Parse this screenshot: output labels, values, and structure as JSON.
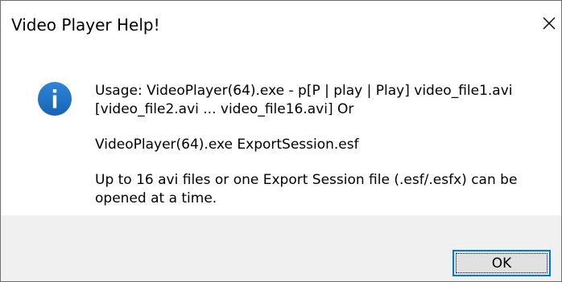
{
  "window": {
    "title": "Video Player Help!"
  },
  "message": {
    "line1": "Usage: VideoPlayer(64).exe - p[P | play | Play]  video_file1.avi",
    "line2": "[video_file2.avi  ...  video_file16.avi] Or",
    "line3": "VideoPlayer(64).exe  ExportSession.esf",
    "line4": "Up to 16 avi files or one Export Session file (.esf/.esfx) can be",
    "line5": "opened at a time."
  },
  "buttons": {
    "ok_label": "OK"
  },
  "icons": {
    "info": "info-icon",
    "close": "close-icon"
  },
  "colors": {
    "info_icon": "#1e74c8",
    "focus_border": "#0078d7",
    "footer_bg": "#f0f0f0"
  }
}
